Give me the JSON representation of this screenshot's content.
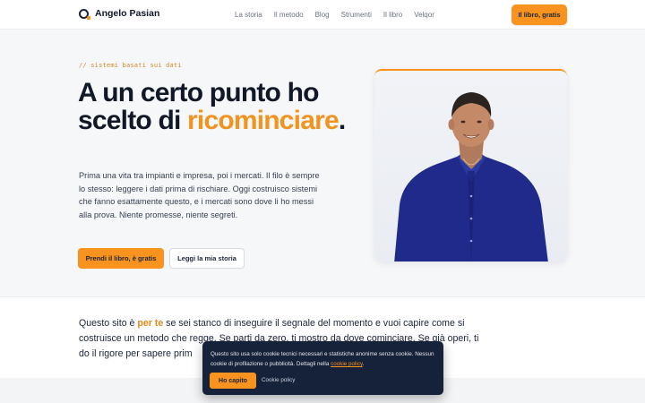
{
  "header": {
    "brand": "Angelo Pasian",
    "nav": [
      "La storia",
      "Il metodo",
      "Blog",
      "Strumenti",
      "Il libro",
      "Velqor"
    ],
    "cta": "Il libro, gratis"
  },
  "hero": {
    "eyebrow": "// sistemi basati sui dati",
    "title_main": "A un certo punto ho scelto di ",
    "title_accent": "ricominciare",
    "title_end": ".",
    "text": "Prima una vita tra impianti e impresa, poi i mercati. Il filo è sempre lo stesso: leggere i dati prima di rischiare. Oggi costruisco sistemi che fanno esattamente questo, e i mercati sono dove li ho messi alla prova. Niente promesse, niente segreti.",
    "btn_primary": "Prendi il libro, è gratis",
    "btn_secondary": "Leggi la mia storia"
  },
  "intro": {
    "part1": "Questo sito è ",
    "highlight": "per te",
    "part2": " se sei stanco di inseguire il segnale del momento e vuoi capire come si costruisce un metodo che regge. Se parti da zero, ti mostro da dove cominciare. Se già operi, ti do il rigore per sapere prim"
  },
  "cookie": {
    "text": "Questo sito usa solo cookie tecnici necessari e statistiche anonime senza cookie. Nessun cookie di profilazione o pubblicità. Dettagli nella ",
    "link": "cookie policy",
    "text_end": ".",
    "accept": "Ho capito",
    "policy_link": "Cookie policy"
  },
  "colors": {
    "accent": "#f7931e",
    "dark": "#16213a",
    "shirt": "#1f2a8a"
  }
}
